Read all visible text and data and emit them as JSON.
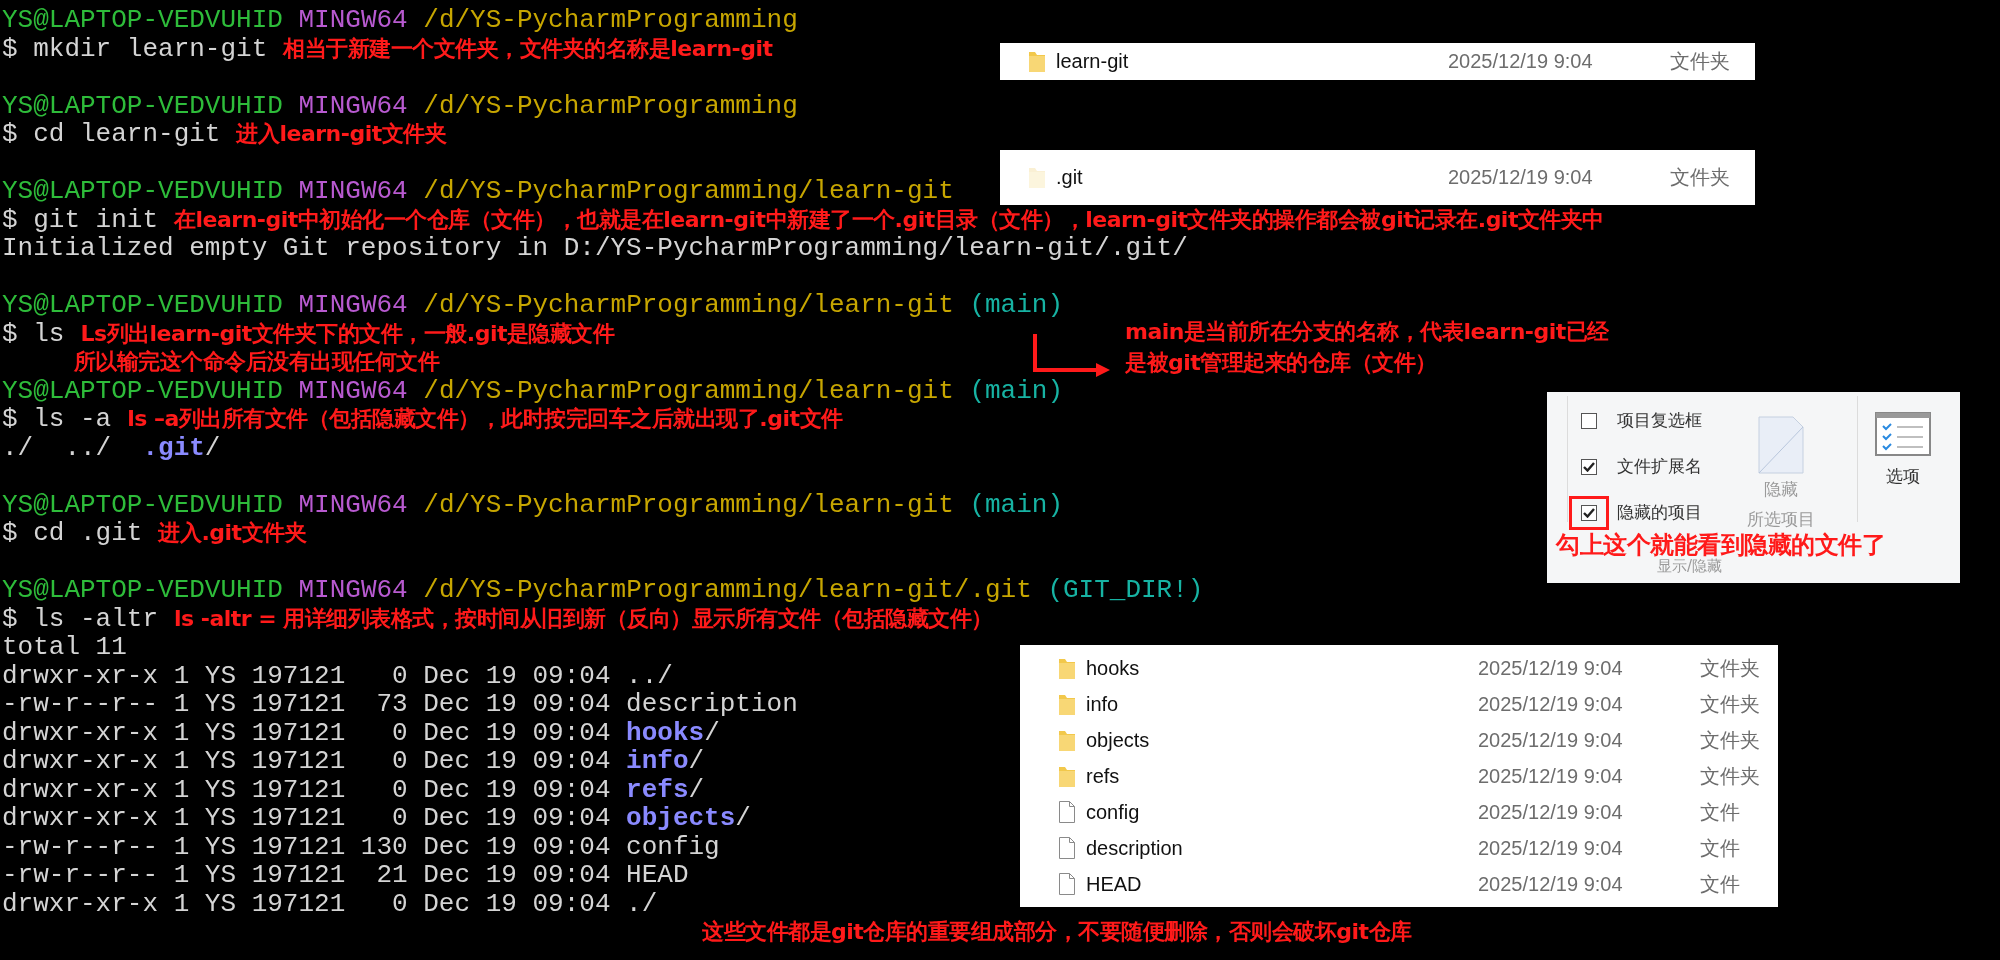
{
  "terminal": {
    "blocks": [
      {
        "prompt": {
          "user": "YS@LAPTOP-VEDVUHID",
          "system": "MINGW64",
          "path": "/d/YS-PycharmProgramming"
        },
        "command": "$ mkdir learn-git",
        "note": [
          "相当于新建一个文件夹，文件夹的名称是learn-git"
        ]
      },
      {
        "prompt": {
          "user": "YS@LAPTOP-VEDVUHID",
          "system": "MINGW64",
          "path": "/d/YS-PycharmProgramming"
        },
        "command": "$ cd learn-git",
        "note": [
          "进入learn-git文件夹"
        ]
      },
      {
        "prompt": {
          "user": "YS@LAPTOP-VEDVUHID",
          "system": "MINGW64",
          "path": "/d/YS-PycharmProgramming/learn-git"
        },
        "command": "$ git init",
        "note": [
          "在learn-git中初始化一个仓库（文件），也就是在learn-git中新建了一个.git目录（文件），learn-git文件夹的操作都会被git记录在.git文件夹中"
        ],
        "output": [
          [
            {
              "text": "Initialized empty Git repository in D:/YS-PycharmProgramming/learn-git/.git/",
              "kind": "plain"
            }
          ]
        ]
      },
      {
        "prompt": {
          "user": "YS@LAPTOP-VEDVUHID",
          "system": "MINGW64",
          "path": "/d/YS-PycharmProgramming/learn-git",
          "branch": "(main)"
        },
        "command": "$ ls",
        "note": [
          "Ls列出learn-git文件夹下的文件，一般.git是隐藏文件",
          "所以输完这个命令后没有出现任何文件"
        ]
      },
      {
        "prompt": {
          "user": "YS@LAPTOP-VEDVUHID",
          "system": "MINGW64",
          "path": "/d/YS-PycharmProgramming/learn-git",
          "branch": "(main)"
        },
        "command": "$ ls -a",
        "note": [
          "ls –a列出所有文件（包括隐藏文件），此时按完回车之后就出现了.git文件"
        ],
        "output": [
          [
            {
              "text": "./  ../  ",
              "kind": "plain"
            },
            {
              "text": ".git",
              "kind": "dir"
            },
            {
              "text": "/",
              "kind": "plain"
            }
          ]
        ]
      },
      {
        "prompt": {
          "user": "YS@LAPTOP-VEDVUHID",
          "system": "MINGW64",
          "path": "/d/YS-PycharmProgramming/learn-git",
          "branch": "(main)"
        },
        "command": "$ cd .git",
        "note": [
          "进入.git文件夹"
        ]
      },
      {
        "prompt": {
          "user": "YS@LAPTOP-VEDVUHID",
          "system": "MINGW64",
          "path": "/d/YS-PycharmProgramming/learn-git/.git",
          "branch": "(GIT_DIR!)"
        },
        "command": "$ ls -altr",
        "note": [
          "ls -altr = 用详细列表格式，按时间从旧到新（反向）显示所有文件（包括隐藏文件）"
        ],
        "output": [
          [
            {
              "text": "total 11",
              "kind": "plain"
            }
          ],
          [
            {
              "text": "drwxr-xr-x 1 YS 197121   0 Dec 19 09:04 ../",
              "kind": "plain"
            }
          ],
          [
            {
              "text": "-rw-r--r-- 1 YS 197121  73 Dec 19 09:04 description",
              "kind": "plain"
            }
          ],
          [
            {
              "text": "drwxr-xr-x 1 YS 197121   0 Dec 19 09:04 ",
              "kind": "plain"
            },
            {
              "text": "hooks",
              "kind": "dir"
            },
            {
              "text": "/",
              "kind": "plain"
            }
          ],
          [
            {
              "text": "drwxr-xr-x 1 YS 197121   0 Dec 19 09:04 ",
              "kind": "plain"
            },
            {
              "text": "info",
              "kind": "dir"
            },
            {
              "text": "/",
              "kind": "plain"
            }
          ],
          [
            {
              "text": "drwxr-xr-x 1 YS 197121   0 Dec 19 09:04 ",
              "kind": "plain"
            },
            {
              "text": "refs",
              "kind": "dir"
            },
            {
              "text": "/",
              "kind": "plain"
            }
          ],
          [
            {
              "text": "drwxr-xr-x 1 YS 197121   0 Dec 19 09:04 ",
              "kind": "plain"
            },
            {
              "text": "objects",
              "kind": "dir"
            },
            {
              "text": "/",
              "kind": "plain"
            }
          ],
          [
            {
              "text": "-rw-r--r-- 1 YS 197121 130 Dec 19 09:04 config",
              "kind": "plain"
            }
          ],
          [
            {
              "text": "-rw-r--r-- 1 YS 197121  21 Dec 19 09:04 HEAD",
              "kind": "plain"
            }
          ],
          [
            {
              "text": "drwxr-xr-x 1 YS 197121   0 Dec 19 09:04 ./",
              "kind": "plain"
            }
          ]
        ]
      }
    ],
    "footer_note": "这些文件都是git仓库的重要组成部分，不要随便删除，否则会破坏git仓库"
  },
  "explorer_panels": [
    {
      "rows": [
        {
          "kind": "folder",
          "name": "learn-git",
          "date": "2025/12/19 9:04",
          "type": "文件夹",
          "hidden": false
        }
      ]
    },
    {
      "rows": [
        {
          "kind": "folder",
          "name": ".git",
          "date": "2025/12/19 9:04",
          "type": "文件夹",
          "hidden": true
        }
      ]
    },
    {
      "rows": [
        {
          "kind": "folder",
          "name": "hooks",
          "date": "2025/12/19 9:04",
          "type": "文件夹",
          "hidden": false
        },
        {
          "kind": "folder",
          "name": "info",
          "date": "2025/12/19 9:04",
          "type": "文件夹",
          "hidden": false
        },
        {
          "kind": "folder",
          "name": "objects",
          "date": "2025/12/19 9:04",
          "type": "文件夹",
          "hidden": false
        },
        {
          "kind": "folder",
          "name": "refs",
          "date": "2025/12/19 9:04",
          "type": "文件夹",
          "hidden": false
        },
        {
          "kind": "file",
          "name": "config",
          "date": "2025/12/19 9:04",
          "type": "文件",
          "hidden": false
        },
        {
          "kind": "file",
          "name": "description",
          "date": "2025/12/19 9:04",
          "type": "文件",
          "hidden": false
        },
        {
          "kind": "file",
          "name": "HEAD",
          "date": "2025/12/19 9:04",
          "type": "文件",
          "hidden": false
        }
      ]
    }
  ],
  "branch_note": [
    "main是当前所在分支的名称，代表learn-git已经",
    "是被git管理起来的仓库（文件）"
  ],
  "ribbon": {
    "checkboxes": [
      {
        "label": "项目复选框",
        "checked": false,
        "highlighted": false
      },
      {
        "label": "文件扩展名",
        "checked": true,
        "highlighted": false
      },
      {
        "label": "隐藏的项目",
        "checked": true,
        "highlighted": true
      }
    ],
    "hide_button": {
      "label": [
        "隐藏",
        "所选项目"
      ],
      "disabled": true
    },
    "options_button": {
      "label": "选项"
    },
    "group_label": "显示/隐藏",
    "note": "勾上这个就能看到隐藏的文件了"
  }
}
